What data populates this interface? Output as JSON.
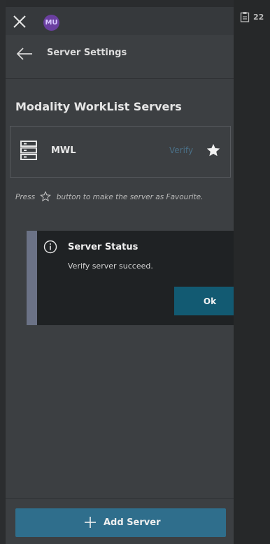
{
  "topbar": {
    "close_icon": "close-icon",
    "avatar_initials": "MU",
    "avatar_color": "#6a3fa0"
  },
  "header": {
    "back_icon": "arrow-left-icon",
    "title": "Server Settings"
  },
  "section": {
    "title": "Modality WorkList Servers"
  },
  "server": {
    "icon": "server-icon",
    "name": "MWL",
    "verify_label": "Verify",
    "favorite_icon": "star-filled-icon"
  },
  "hint": {
    "before": "Press",
    "icon": "star-outline-icon",
    "after": "button to make the server as Favourite."
  },
  "dialog": {
    "icon": "info-icon",
    "title": "Server Status",
    "message": "Verify server succeed.",
    "ok_label": "Ok",
    "accent_color": "#6b7286"
  },
  "footer": {
    "add_icon": "plus-icon",
    "add_label": "Add Server",
    "button_color": "#2f6e8c"
  },
  "right_panel": {
    "icon": "clipboard-icon",
    "count": "22"
  }
}
